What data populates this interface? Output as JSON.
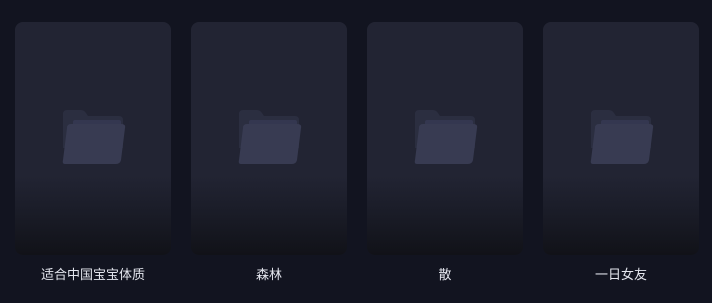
{
  "albums": [
    {
      "name": "适合中国宝宝体质",
      "icon": "folder-icon"
    },
    {
      "name": "森林",
      "icon": "folder-icon"
    },
    {
      "name": "散",
      "icon": "folder-icon"
    },
    {
      "name": "一日女友",
      "icon": "folder-icon"
    }
  ],
  "colors": {
    "background": "#121420",
    "card": "#222433",
    "folder_back": "#2b2e40",
    "folder_front": "#383b52",
    "label": "#e4e6ee"
  }
}
